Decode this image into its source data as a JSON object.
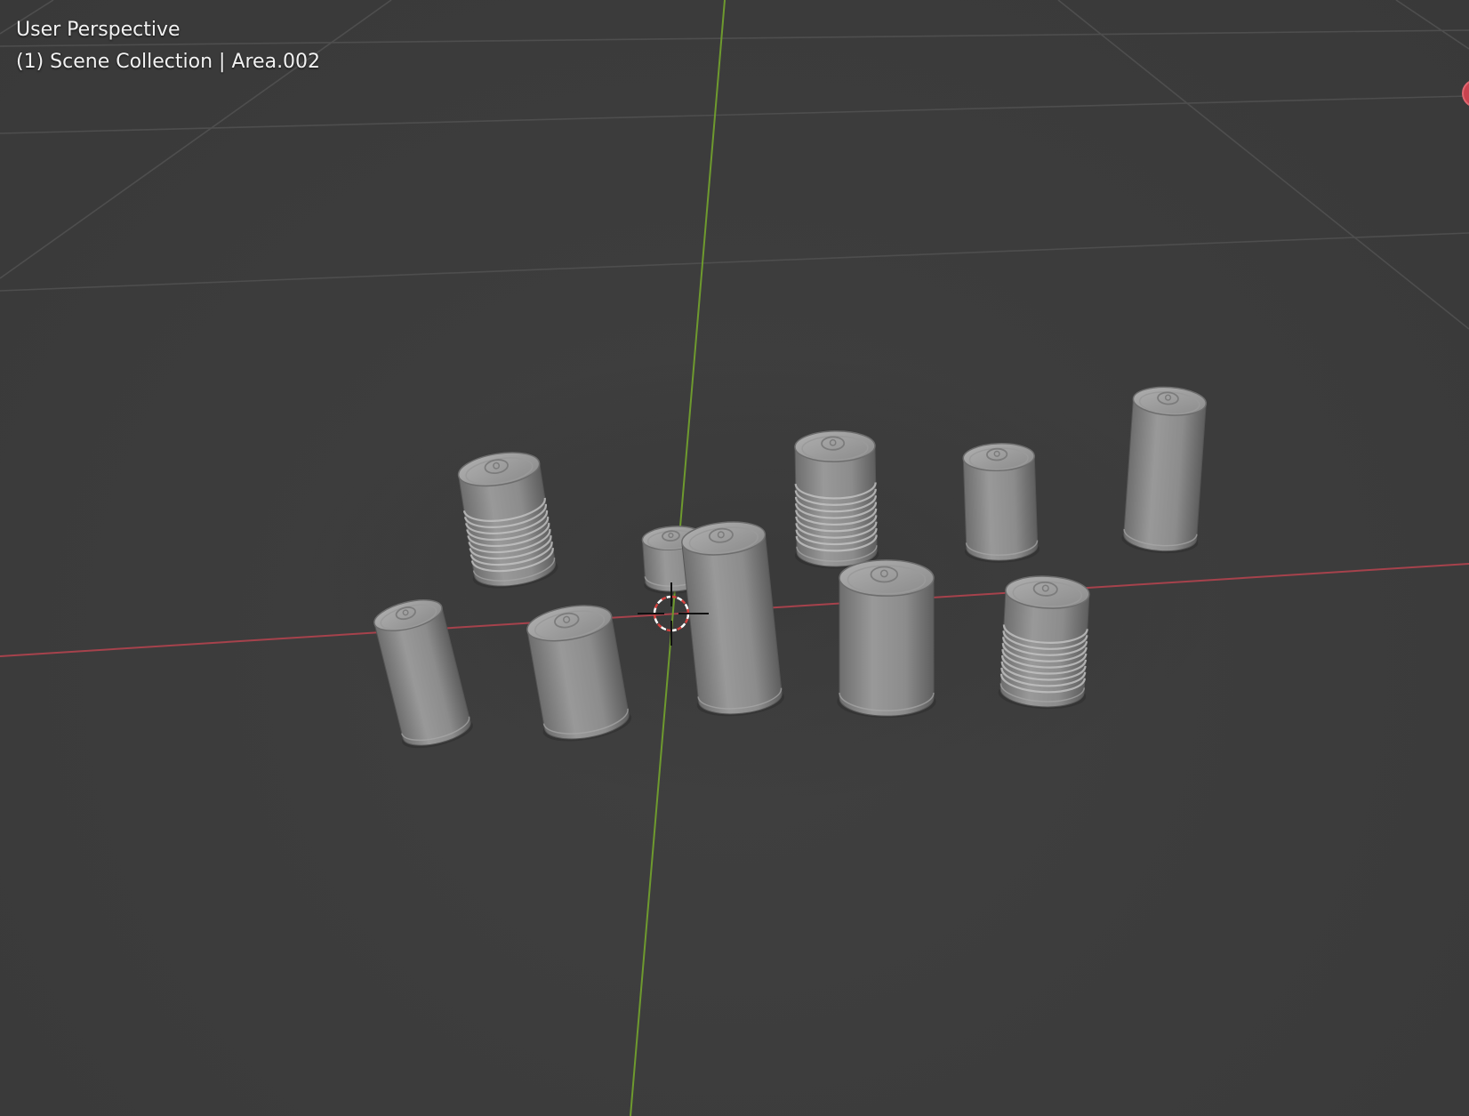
{
  "viewport": {
    "view_name": "User Perspective",
    "context": "(1) Scene Collection | Area.002",
    "colors": {
      "background": "#3d3d3d",
      "grid": "#4e4e4e",
      "x_axis": "#a6424c",
      "y_axis": "#6e9a2e",
      "can_body": "#8c8c8c"
    },
    "objects": [
      {
        "kind": "food-can"
      },
      {
        "kind": "food-can"
      },
      {
        "kind": "short-can"
      },
      {
        "kind": "soda-can"
      },
      {
        "kind": "tall-can"
      },
      {
        "kind": "tall-can"
      },
      {
        "kind": "soda-can"
      },
      {
        "kind": "soda-can"
      },
      {
        "kind": "tall-can"
      },
      {
        "kind": "food-can"
      },
      {
        "kind": "soda-can"
      }
    ],
    "icons": {
      "cursor": "3d-cursor-icon",
      "gizmo": "navigation-gizmo-icon"
    }
  }
}
